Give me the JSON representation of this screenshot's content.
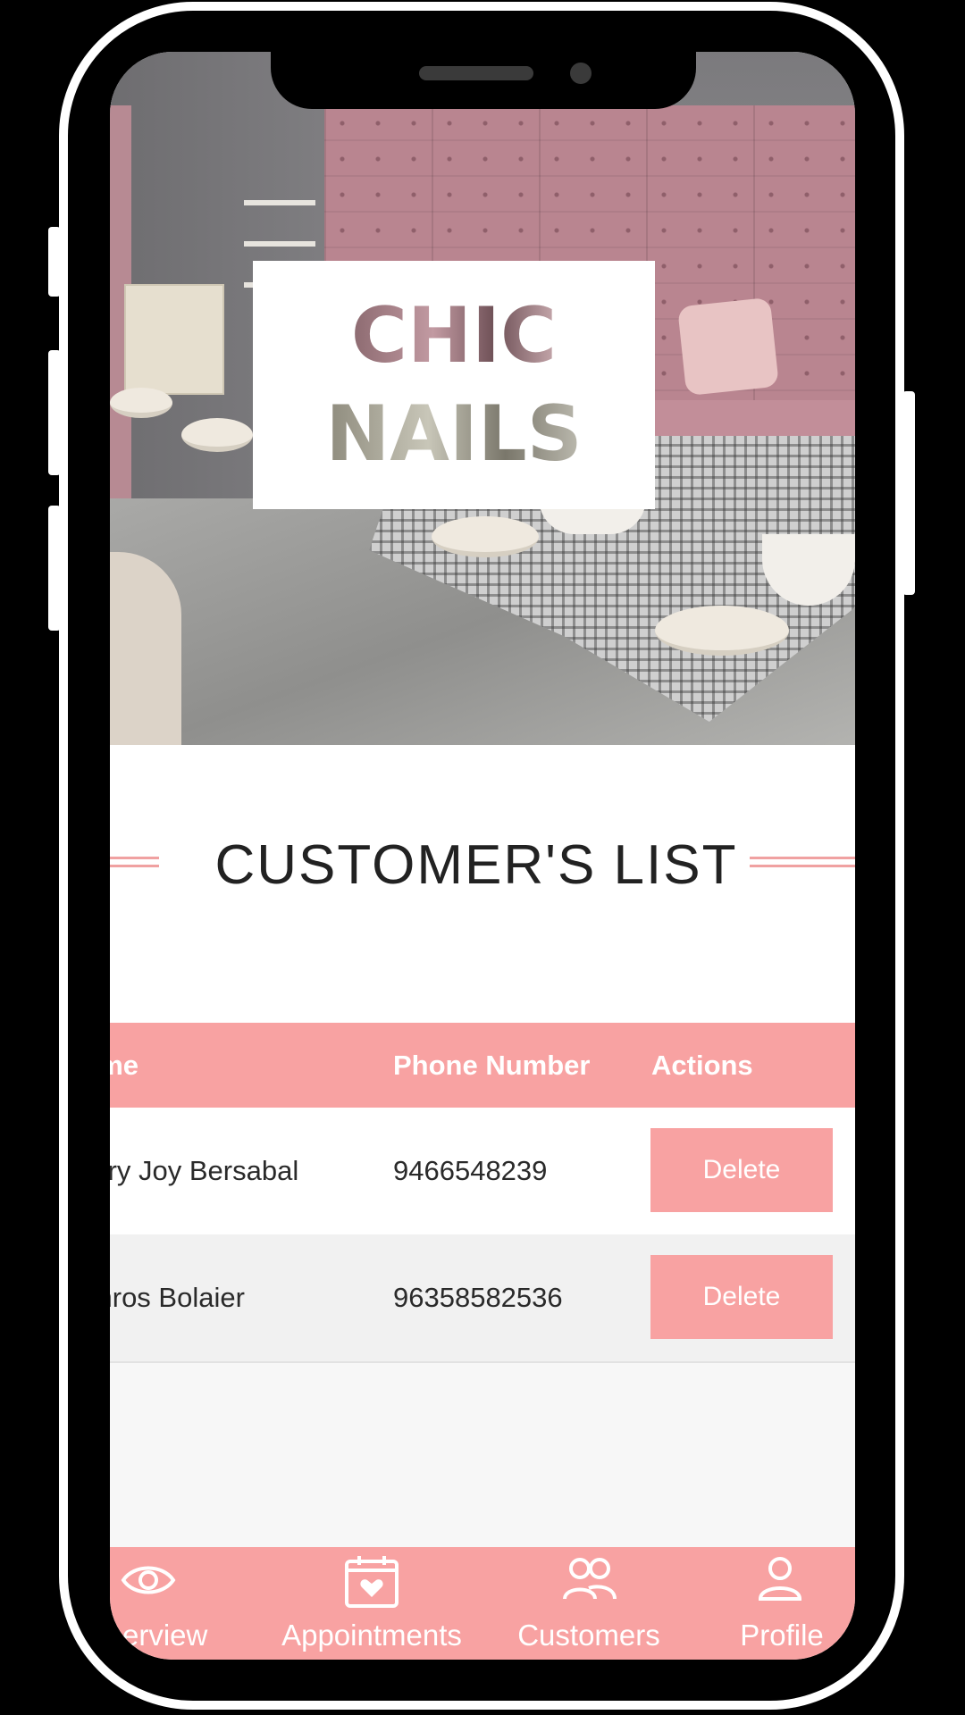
{
  "brand": {
    "logo_line_1": "CHIC",
    "logo_line_2": "NAILS"
  },
  "section": {
    "title": "CUSTOMER'S LIST"
  },
  "table": {
    "columns": [
      "ame",
      "Phone Number",
      "Actions"
    ],
    "rows": [
      {
        "name": "arry Joy Bersabal",
        "phone": "9466548239",
        "action_label": "Delete"
      },
      {
        "name": "ynros Bolaier",
        "phone": "96358582536",
        "action_label": "Delete"
      }
    ]
  },
  "bottom_nav": {
    "items": [
      {
        "label": "erview",
        "icon": "eye-icon"
      },
      {
        "label": "Appointments",
        "icon": "calendar-heart-icon"
      },
      {
        "label": "Customers",
        "icon": "users-icon"
      },
      {
        "label": "Profile",
        "icon": "user-icon"
      }
    ]
  },
  "colors": {
    "accent": "#f8a2a2",
    "title_text": "#222222",
    "row_alt_bg": "#f1f1f1"
  }
}
